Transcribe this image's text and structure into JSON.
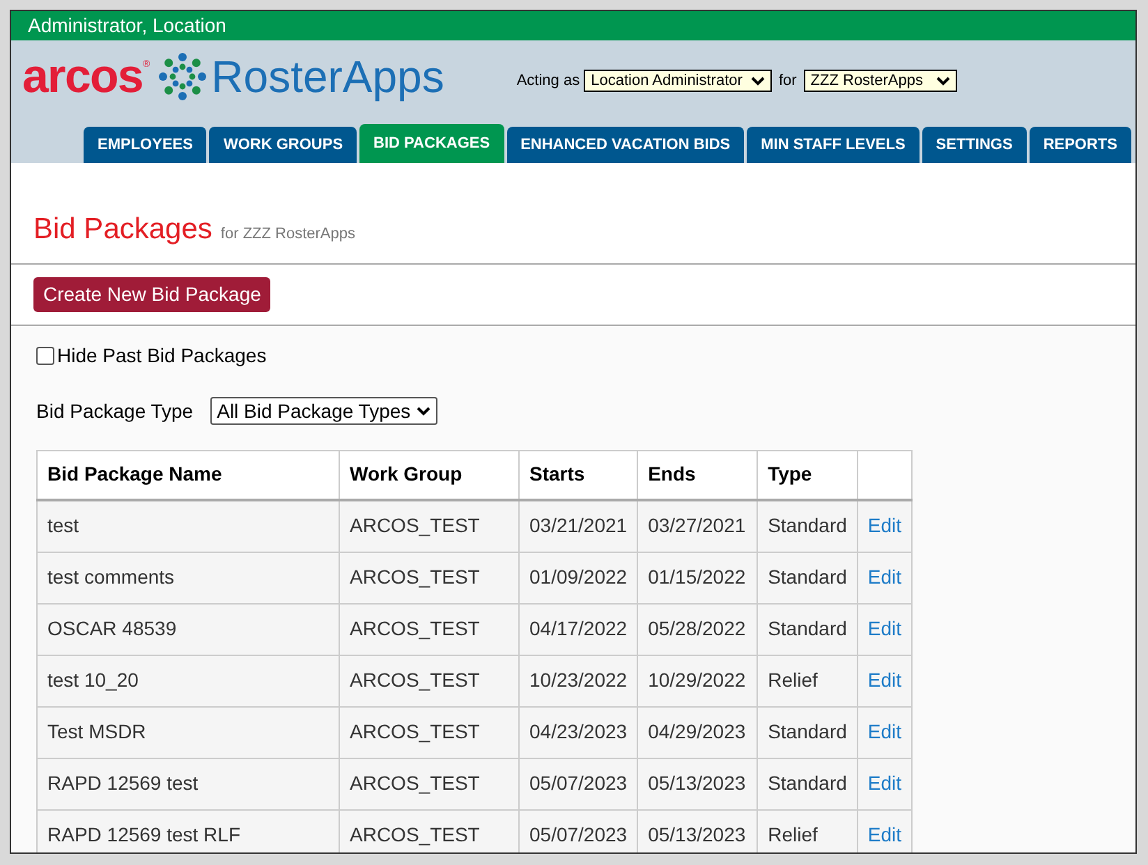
{
  "user_bar": {
    "name": "Administrator, Location"
  },
  "logo": {
    "brand": "arcos",
    "registered": "®",
    "product": "RosterApps"
  },
  "acting": {
    "label": "Acting as",
    "role": "Location Administrator",
    "for_label": "for",
    "location": "ZZZ RosterApps"
  },
  "tabs": [
    {
      "label": "EMPLOYEES",
      "selected": false
    },
    {
      "label": "WORK GROUPS",
      "selected": false
    },
    {
      "label": "BID PACKAGES",
      "selected": true
    },
    {
      "label": "ENHANCED VACATION BIDS",
      "selected": false
    },
    {
      "label": "MIN STAFF LEVELS",
      "selected": false
    },
    {
      "label": "SETTINGS",
      "selected": false
    },
    {
      "label": "REPORTS",
      "selected": false
    }
  ],
  "page": {
    "title": "Bid Packages",
    "subtitle": "for ZZZ RosterApps",
    "create_button": "Create New Bid Package"
  },
  "filters": {
    "hide_past": {
      "label": "Hide Past Bid Packages",
      "checked": false
    },
    "type_label": "Bid Package Type",
    "type_value": "All Bid Package Types"
  },
  "table": {
    "columns": [
      "Bid Package Name",
      "Work Group",
      "Starts",
      "Ends",
      "Type"
    ],
    "rows": [
      {
        "cells": [
          "test",
          "ARCOS_TEST",
          "03/21/2021",
          "03/27/2021",
          "Standard"
        ],
        "action": "Edit"
      },
      {
        "cells": [
          "test comments",
          "ARCOS_TEST",
          "01/09/2022",
          "01/15/2022",
          "Standard"
        ],
        "action": "Edit"
      },
      {
        "cells": [
          "OSCAR 48539",
          "ARCOS_TEST",
          "04/17/2022",
          "05/28/2022",
          "Standard"
        ],
        "action": "Edit"
      },
      {
        "cells": [
          "test 10_20",
          "ARCOS_TEST",
          "10/23/2022",
          "10/29/2022",
          "Relief"
        ],
        "action": "Edit"
      },
      {
        "cells": [
          "Test MSDR",
          "ARCOS_TEST",
          "04/23/2023",
          "04/29/2023",
          "Standard"
        ],
        "action": "Edit"
      },
      {
        "cells": [
          "RAPD 12569 test",
          "ARCOS_TEST",
          "05/07/2023",
          "05/13/2023",
          "Standard"
        ],
        "action": "Edit"
      },
      {
        "cells": [
          "RAPD 12569 test RLF",
          "ARCOS_TEST",
          "05/07/2023",
          "05/13/2023",
          "Relief"
        ],
        "action": "Edit"
      }
    ]
  }
}
